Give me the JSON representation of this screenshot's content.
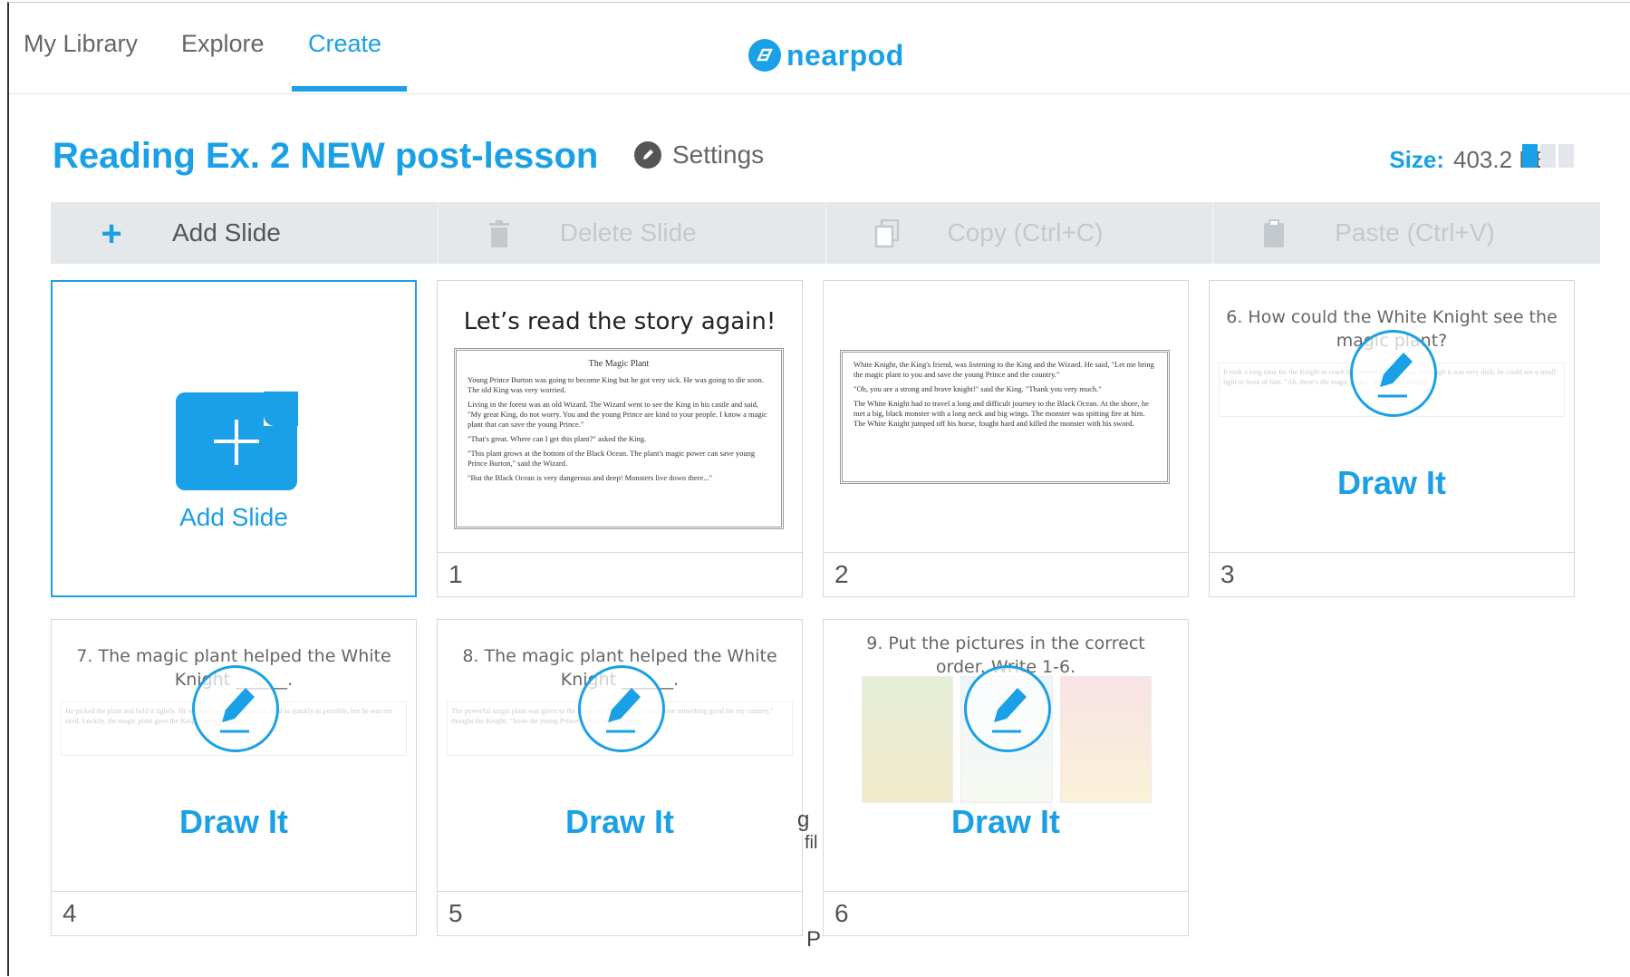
{
  "nav": {
    "tabs": [
      {
        "label": "My Library"
      },
      {
        "label": "Explore"
      },
      {
        "label": "Create"
      }
    ],
    "logo_text": "nearpod"
  },
  "lesson": {
    "title": "Reading Ex. 2 NEW post-lesson",
    "settings_label": "Settings",
    "size_label": "Size:",
    "size_value": "403.2 KB",
    "size_fraction": 0.33
  },
  "toolbar": {
    "add": "Add Slide",
    "delete": "Delete Slide",
    "copy": "Copy (Ctrl+C)",
    "paste": "Paste (Ctrl+V)"
  },
  "add_card": {
    "label": "Add Slide"
  },
  "slides": [
    {
      "number": "1",
      "title": "Let’s read the story again!",
      "story_heading": "The Magic Plant",
      "paragraphs": [
        "Young Prince Burton was going to become King but he got very sick. He was going to die soon. The old King was very worried.",
        "Living in the forest was an old Wizard. The Wizard went to see the King in his castle and said, \"My great King, do not worry. You and the young Prince are kind to your people. I know a magic plant that can save the young Prince.\"",
        "\"That's great. Where can I get this plant?\" asked the King.",
        "\"This plant grows at the bottom of the Black Ocean. The plant's magic power can save young Prince Burton,\" said the Wizard.",
        "\"But the Black Ocean is very dangerous and deep! Monsters live down there...\""
      ]
    },
    {
      "number": "2",
      "paragraphs": [
        "White Knight, the King's friend, was listening to the King and the Wizard. He said, \"Let me bring the magic plant to you and save the young Prince and the country.\"",
        "\"Oh, you are a strong and brave knight!\" said the King. \"Thank you very much.\"",
        "The White Knight had to travel a long and difficult journey to the Black Ocean. At the shore, he met a big, black monster with a long neck and big wings. The monster was spitting fire at him. The White Knight jumped off his horse, fought hard and killed the monster with his sword."
      ]
    },
    {
      "number": "3",
      "question": "6. How could the White Knight see the magic plant?",
      "faded_text": "It took a long time for the Knight to reach the bottom of the ocean. Although it was very dark, he could see a small light in front of him. \"Ah, there's the magic plant!\" thought the Knight.",
      "label": "Draw It"
    },
    {
      "number": "4",
      "question": "7. The magic plant helped the White Knight ______.",
      "faded_text": "He picked the plant and held it tightly. He wanted to swim back to the land as quickly as possible, but he was too tired. Luckily, the magic plant gave the Knight great strength.",
      "label": "Draw It"
    },
    {
      "number": "5",
      "question": "8. The magic plant helped the White Knight ______.",
      "faded_text": "The powerful magic plant was given to the King and the Prince. \"I have done something good for my country,\" thought the Knight. \"Soon the young Prince will be healthy again.\"",
      "label": "Draw It"
    },
    {
      "number": "6",
      "question": "9. Put the pictures in the correct order. Write 1-6.",
      "label": "Draw It"
    }
  ],
  "background_peek": {
    "a": "g",
    "b": "fil",
    "c": "P"
  }
}
